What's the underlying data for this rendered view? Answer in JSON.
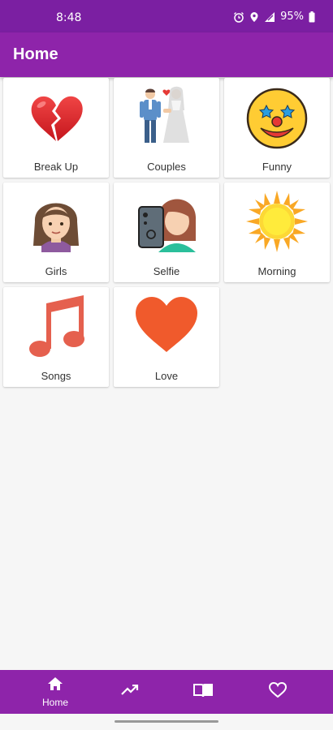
{
  "status_bar": {
    "time": "8:48",
    "battery": "95%"
  },
  "app_bar": {
    "title": "Home"
  },
  "categories": [
    {
      "label": "Break Up",
      "icon": "broken-heart-icon"
    },
    {
      "label": "Couples",
      "icon": "couple-icon"
    },
    {
      "label": "Funny",
      "icon": "clown-face-icon"
    },
    {
      "label": "Girls",
      "icon": "girl-face-icon"
    },
    {
      "label": "Selfie",
      "icon": "selfie-icon"
    },
    {
      "label": "Morning",
      "icon": "sun-icon"
    },
    {
      "label": "Songs",
      "icon": "music-note-icon"
    },
    {
      "label": "Love",
      "icon": "heart-icon"
    }
  ],
  "bottom_nav": {
    "home_label": "Home",
    "items": [
      "home-icon",
      "trending-icon",
      "book-icon",
      "favorite-icon"
    ]
  },
  "colors": {
    "status_bar": "#7b1fa2",
    "app_bar": "#8e24aa",
    "background": "#f6f6f6"
  }
}
